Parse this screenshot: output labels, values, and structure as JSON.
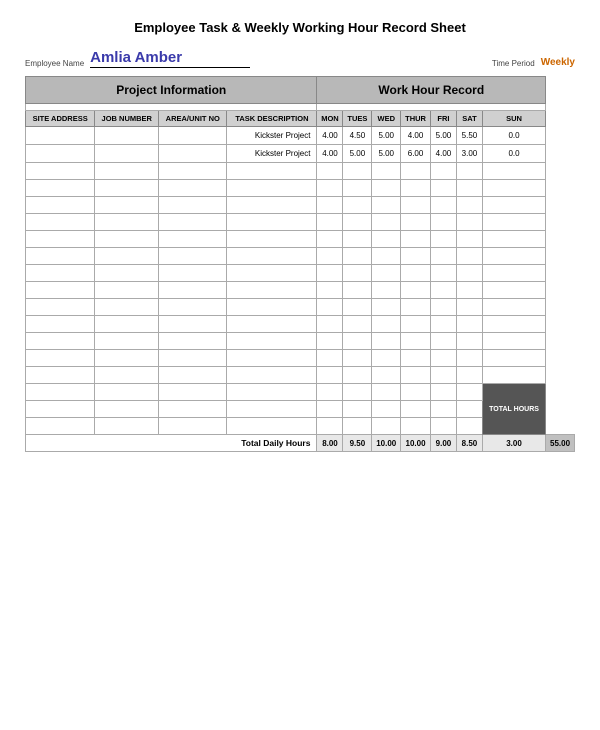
{
  "page": {
    "title": "Employee Task & Weekly Working Hour Record Sheet"
  },
  "header": {
    "employee_name_label": "Employee Name",
    "employee_name_value": "Amlia Amber",
    "time_period_label": "Time Period",
    "time_period_value": "Weekly"
  },
  "sections": {
    "project_info_label": "Project Information",
    "work_hour_record_label": "Work Hour Record"
  },
  "columns": {
    "project": [
      "SITE ADDRESS",
      "JOB NUMBER",
      "AREA/UNIT NO",
      "TASK DESCRIPTION"
    ],
    "hours": [
      "MON",
      "TUES",
      "WED",
      "THUR",
      "FRI",
      "SAT",
      "SUN"
    ]
  },
  "rows": [
    {
      "site": "",
      "job": "",
      "area": "",
      "task": "Kickster Project",
      "mon": "4.00",
      "tues": "4.50",
      "wed": "5.00",
      "thur": "4.00",
      "fri": "5.00",
      "sat": "5.50",
      "sun": "0.0"
    },
    {
      "site": "",
      "job": "",
      "area": "",
      "task": "Kickster Project",
      "mon": "4.00",
      "tues": "5.00",
      "wed": "5.00",
      "thur": "6.00",
      "fri": "4.00",
      "sat": "3.00",
      "sun": "0.0"
    }
  ],
  "empty_rows": 15,
  "totals": {
    "label": "Total Daily Hours",
    "mon": "8.00",
    "tues": "9.50",
    "wed": "10.00",
    "thur": "10.00",
    "fri": "9.00",
    "sat": "8.50",
    "sun": "3.00",
    "total": "55.00",
    "total_hours_label": "TOTAL HOURS"
  }
}
